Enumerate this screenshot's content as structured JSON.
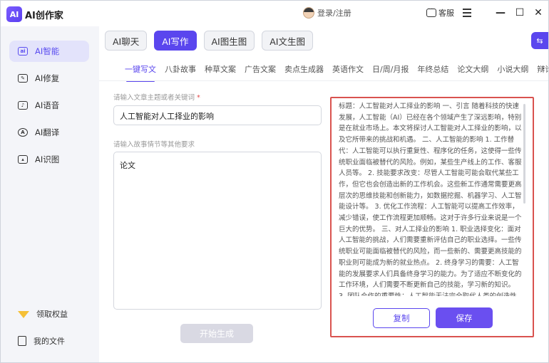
{
  "app": {
    "title": "AI创作家",
    "logo_text": "AI"
  },
  "header": {
    "login_label": "登录/注册",
    "service_label": "客服"
  },
  "sidebar": {
    "items": [
      {
        "label": "AI智能",
        "icon": "ai-smart-icon",
        "active": true
      },
      {
        "label": "AI修复",
        "icon": "repair-icon"
      },
      {
        "label": "AI语音",
        "icon": "voice-icon"
      },
      {
        "label": "AI翻译",
        "icon": "translate-icon"
      },
      {
        "label": "AI识图",
        "icon": "image-recognition-icon"
      }
    ],
    "bottom": [
      {
        "label": "领取权益",
        "icon": "vip-crown-icon"
      },
      {
        "label": "我的文件",
        "icon": "file-icon"
      }
    ]
  },
  "top_tabs": [
    {
      "label": "AI聊天"
    },
    {
      "label": "AI写作",
      "active": true
    },
    {
      "label": "AI图生图"
    },
    {
      "label": "AI文生图"
    }
  ],
  "sub_tabs": [
    "一键写文",
    "八卦故事",
    "种草文案",
    "广告文案",
    "卖点生成器",
    "英语作文",
    "日/周/月报",
    "年终总结",
    "论文大纲",
    "小说大纲",
    "辩论稿"
  ],
  "form": {
    "topic_label": "请输入文章主题或者关键词",
    "topic_required": "*",
    "topic_value": "人工智能对人工择业的影响",
    "detail_label": "请输入故事情节等其他要求",
    "detail_value": "论文",
    "generate_label": "开始生成"
  },
  "result": {
    "text": "标题：人工智能对人工择业的影响 一、引言 随着科技的快速发展，人工智能（AI）已经在各个领域产生了深远影响，特别是在就业市场上。本文将探讨人工智能对人工择业的影响，以及它所带来的挑战和机遇。 二、人工智能的影响 1. 工作替代：人工智能可以执行重复性、程序化的任务，这使得一些传统职业面临被替代的风险。例如，某些生产线上的工作、客服人员等。 2. 技能要求改变：尽管人工智能可能会取代某些工作，但它也会创造出新的工作机会。这些新工作通常需要更高层次的思维技能和创新能力，如数据挖掘、机器学习、人工智能设计等。 3. 优化工作流程：人工智能可以提高工作效率，减少错误，使工作流程更加顺畅。这对于许多行业来说是一个巨大的优势。 三、对人工择业的影响 1. 职业选择变化：面对人工智能的挑战，人们需要重新评估自己的职业选择。一些传统职业可能面临被替代的风险，而一些新的、需要更高技能的职业则可能成为新的就业热点。 2. 终身学习的需要：人工智能的发展要求人们具备终身学习的能力。为了适应不断变化的工作环境，人们需要不断更新自己的技能，学习新的知识。 3. 团队合作的重要性：人工智能无法完全取代人类的创造性思维和人际交往能",
    "copy_label": "复制",
    "save_label": "保存"
  },
  "colors": {
    "accent": "#5a46ee",
    "highlight_border": "#d9534f"
  }
}
